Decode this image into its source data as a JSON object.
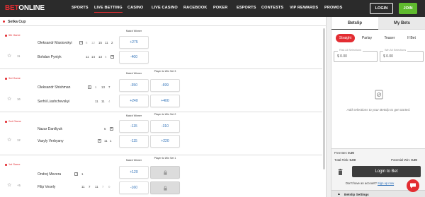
{
  "brand": {
    "part1": "BET",
    "part2": "ONLINE",
    "accent": "#e32d32"
  },
  "nav": {
    "items": [
      "SPORTS",
      "LIVE BETTING",
      "CASINO",
      "LIVE CASINO",
      "RACEBOOK",
      "POKER",
      "ESPORTS",
      "CONTESTS",
      "VIP REWARDS",
      "PROMOS"
    ],
    "active": "LIVE BETTING",
    "login_label": "LOGIN",
    "join_label": "JOIN"
  },
  "competition": {
    "title": "Setka Cup"
  },
  "games": [
    {
      "label": "5th Game",
      "id": "11",
      "markets": [
        "Match Winner"
      ],
      "players": [
        {
          "name": "Oleksandr Masiovskyi",
          "serve": "1",
          "scores": [
            "6",
            "12",
            "15",
            "11",
            "2"
          ],
          "odds": [
            "+275"
          ]
        },
        {
          "name": "Bohdan Pyntyk",
          "serve": "",
          "scores": [
            "11",
            "14",
            "13",
            "5",
            "5"
          ],
          "odds": [
            "-400"
          ]
        }
      ]
    },
    {
      "label": "3rd Game",
      "id": "16",
      "markets": [
        "Match Winner",
        "Player to Win Set 3"
      ],
      "players": [
        {
          "name": "Oleksandr Shishman",
          "serve": "1",
          "scores": [
            "6",
            "13",
            "7"
          ],
          "odds": [
            "-350",
            "-699"
          ]
        },
        {
          "name": "Serhii Liashchevskyi",
          "serve": "",
          "scores": [
            "11",
            "11",
            "4"
          ],
          "odds": [
            "+240",
            "+400"
          ]
        }
      ]
    },
    {
      "label": "2nd Game",
      "id": "12",
      "markets": [
        "Match Winner",
        "Player to Win Set 2"
      ],
      "players": [
        {
          "name": "Nazar Daniliyuk",
          "serve": "",
          "scores": [
            "5",
            "8"
          ],
          "odds": [
            "-115",
            "-310"
          ]
        },
        {
          "name": "Vasyly Verbyany",
          "serve": "1",
          "scores": [
            "11",
            "1"
          ],
          "odds": [
            "-115",
            "+220"
          ]
        }
      ]
    },
    {
      "label": "1st Game",
      "id": "+5",
      "markets": [
        "Match Winner",
        "Player to Win Set 1"
      ],
      "players": [
        {
          "name": "Ondrej Mezera",
          "serve": "1",
          "scores": [
            "1"
          ],
          "odds": [
            "+120",
            ""
          ]
        },
        {
          "name": "Filip Vesely",
          "serve": "",
          "scores": [
            "11",
            "7",
            "11",
            "7",
            "0"
          ],
          "odds": [
            "-160",
            ""
          ]
        }
      ]
    }
  ],
  "betslip": {
    "tabs": [
      "Betslip",
      "My Bets"
    ],
    "types": [
      "Straight",
      "Parlay",
      "Teaser",
      "If Bet"
    ],
    "risk_label": "Risk All Selections",
    "win_label": "Win All Selections",
    "risk_value": "$ 0.00",
    "win_value": "$ 0.00",
    "empty_text": "Add selections to your Betslip to get started.",
    "free_bet_label": "Free Bet:",
    "free_bet_value": "0.00",
    "total_risk_label": "Total Risk:",
    "total_risk_value": "0.00",
    "potential_win_label": "Potential Win:",
    "potential_win_value": "0.00",
    "login_button": "Login to Bet",
    "signup_text": "Don't have an account?",
    "signup_link": "Sign up now",
    "settings_label": "Betslip Settings"
  }
}
